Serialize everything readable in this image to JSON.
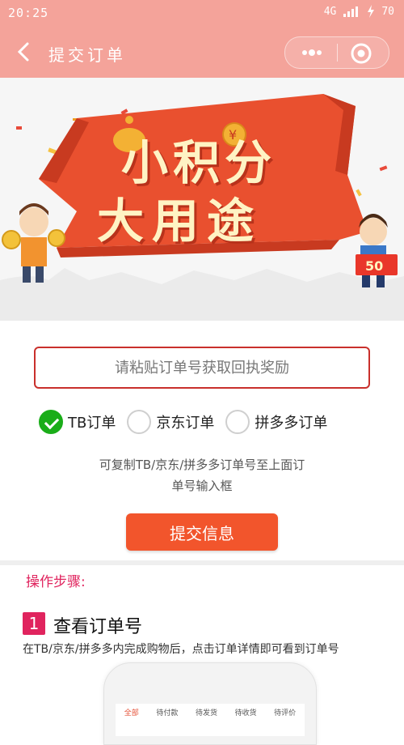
{
  "status_bar": {
    "time": "20:25",
    "network": "4G",
    "battery": "70"
  },
  "header": {
    "title": "提交订单"
  },
  "banner": {
    "line1": "小积分",
    "line2": "大用途",
    "badge_coin": "¥",
    "sign_text": "50"
  },
  "form": {
    "input_placeholder": "请粘贴订单号获取回执奖励",
    "input_value": "",
    "options": [
      {
        "label": "TB订单",
        "checked": true
      },
      {
        "label": "京东订单",
        "checked": false
      },
      {
        "label": "拼多多订单",
        "checked": false
      }
    ],
    "hint_line1": "可复制TB/京东/拼多多订单号至上面订",
    "hint_line2": "单号输入框",
    "submit_label": "提交信息"
  },
  "steps": {
    "section_title": "操作步骤:",
    "step1": {
      "number": "1",
      "title": "查看订单号",
      "description": "在TB/京东/拼多多内完成购物后，点击订单详情即可看到订单号"
    },
    "phone_tabs": [
      "全部",
      "待付款",
      "待发货",
      "待收货",
      "待评价"
    ]
  },
  "colors": {
    "header_bg": "#f4a39a",
    "accent_red": "#f2552c",
    "step_pink": "#e0245e",
    "check_green": "#1aad19"
  }
}
